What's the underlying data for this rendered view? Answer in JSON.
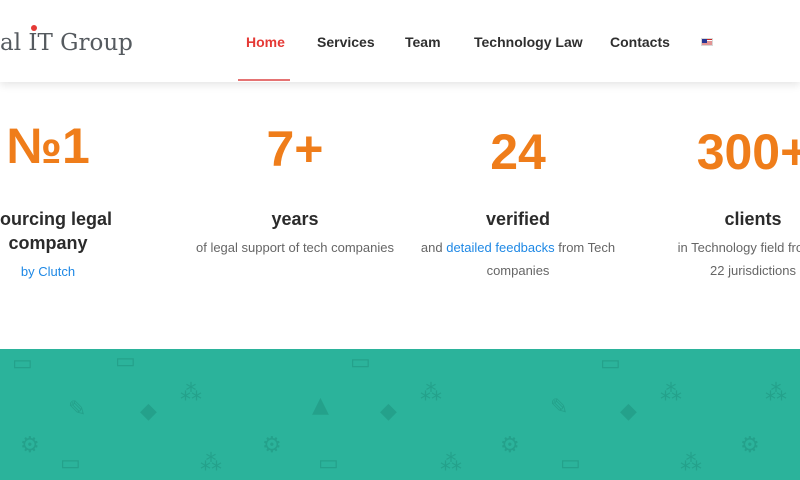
{
  "header": {
    "logo": {
      "pre": "al ",
      "i": "I",
      "post": "T Group"
    },
    "nav": [
      {
        "label": "Home",
        "active": true
      },
      {
        "label": "Services",
        "active": false
      },
      {
        "label": "Team",
        "active": false
      },
      {
        "label": "Technology Law",
        "active": false
      },
      {
        "label": "Contacts",
        "active": false
      }
    ],
    "language_icon": "us-flag-icon"
  },
  "stats": [
    {
      "value": "№1",
      "label_line1": "tsourcing legal",
      "label_line2": "company",
      "desc_link": "by Clutch"
    },
    {
      "value": "7+",
      "label": "years",
      "desc": "of legal support of tech companies"
    },
    {
      "value": "24",
      "label": "verified",
      "desc_pre": "and ",
      "desc_link": "detailed feedbacks",
      "desc_post": " from Tech",
      "desc_line2": "companies"
    },
    {
      "value": "300+",
      "label": "clients",
      "desc_line1": "in Technology field from m",
      "desc_line2": "22 jurisdictions"
    }
  ],
  "colors": {
    "accent_orange": "#ef7d1a",
    "nav_active": "#e53935",
    "link_blue": "#1e88e5",
    "band_teal": "#2bb39b"
  }
}
